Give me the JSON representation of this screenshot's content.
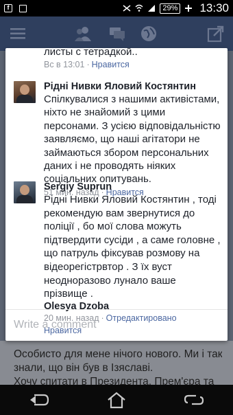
{
  "status_bar": {
    "battery": "29%",
    "time": "13:30"
  },
  "first_comment": {
    "text": "листы с тетрадкой..",
    "time": "Вс в 13:01",
    "like": "Нравится"
  },
  "comments": [
    {
      "author": "Рідні Нивки Яловий Костянтин",
      "text": "Спілкувалися з нашими активістами, ніхто не знайомий з цими персонами. З усією відповідальністю заявляємо, що наші агітатори не займаються збором персональних даних і не проводять ніяких соціальних опитувань.",
      "time": "51 мин. назад",
      "like": "Нравится"
    },
    {
      "author": "Sergiy Suprun",
      "text": "Рідні Нивки Яловий Костянтин , тоді рекомендую вам звернутися до поліції , бо мої слова можуть підтвердити сусіди , а саме головне , що патруль фіксував розмову на відеорегістрвтор . З їх вуст неодноразово лунало ваше прізвище .",
      "sub_author": "Olesya Dzoba",
      "time": "20 мин. назад",
      "edited": "Отредактировано",
      "like": "Нравится"
    }
  ],
  "composer": {
    "placeholder": "Write a comment"
  },
  "background_post": {
    "line1": "Особисто для мене нічого нового. Ми і так",
    "line2": "знали, що він був в Ізяславі.",
    "line3": "Хочу спитати в Президента, Прем'єра та"
  },
  "icons": {
    "menu": "menu-icon",
    "friends": "friends-icon",
    "messages": "messages-icon",
    "globe": "globe-icon",
    "share": "share-icon",
    "back": "back-icon",
    "home": "home-icon",
    "recent": "recent-apps-icon"
  }
}
